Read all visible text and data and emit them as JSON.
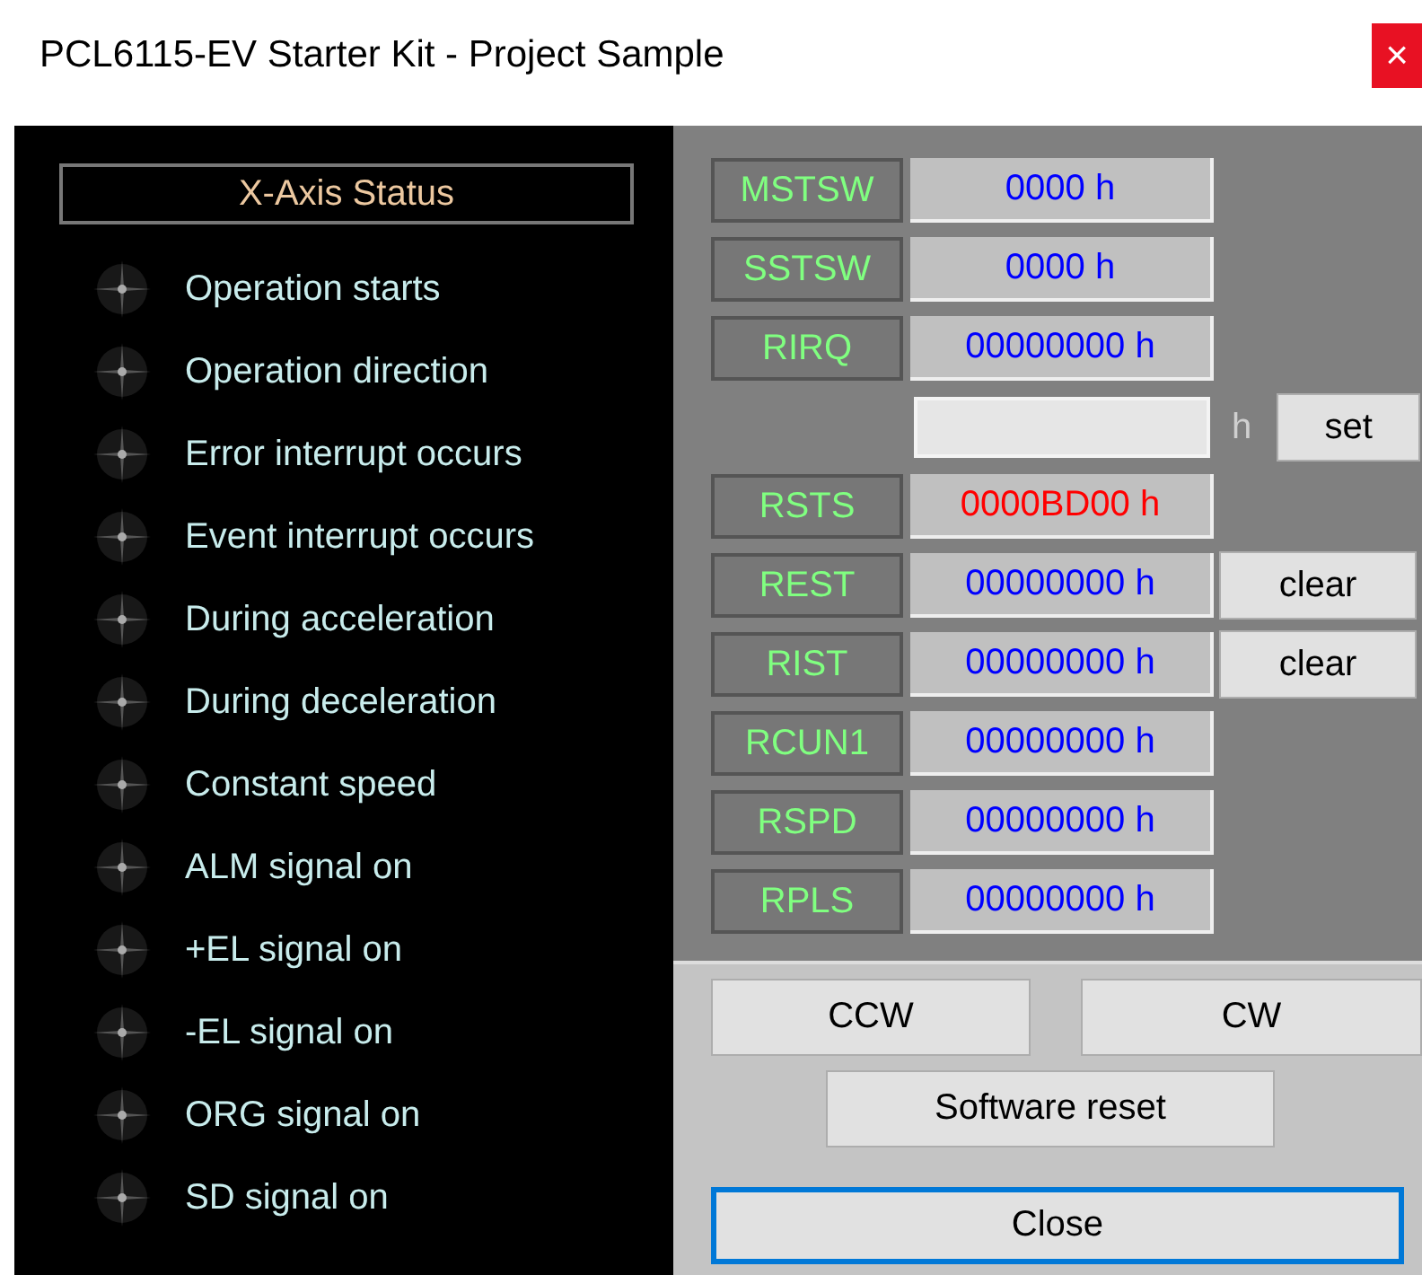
{
  "window": {
    "title": "PCL6115-EV Starter Kit - Project Sample",
    "close": "×"
  },
  "status": {
    "title": "X-Axis  Status",
    "items": [
      {
        "label": "Operation starts",
        "on": false
      },
      {
        "label": "Operation direction",
        "on": false
      },
      {
        "label": "Error interrupt occurs",
        "on": false
      },
      {
        "label": "Event interrupt occurs",
        "on": false
      },
      {
        "label": "During acceleration",
        "on": false
      },
      {
        "label": "During deceleration",
        "on": false
      },
      {
        "label": "Constant speed",
        "on": false
      },
      {
        "label": "ALM signal on",
        "on": false
      },
      {
        "label": "+EL signal on",
        "on": false
      },
      {
        "label": "-EL signal on",
        "on": false
      },
      {
        "label": "ORG signal on",
        "on": false
      },
      {
        "label": "SD signal on",
        "on": false
      }
    ]
  },
  "registers": [
    {
      "kind": "register",
      "name": "MSTSW",
      "value": "0000 h",
      "color": "#0000ff"
    },
    {
      "kind": "register",
      "name": "SSTSW",
      "value": "0000 h",
      "color": "#0000ff"
    },
    {
      "kind": "register",
      "name": "RIRQ",
      "value": "00000000 h",
      "color": "#0000ff"
    },
    {
      "kind": "input",
      "unit": "h",
      "button": "set"
    },
    {
      "kind": "register",
      "name": "RSTS",
      "value": "0000BD00 h",
      "color": "#ff0000"
    },
    {
      "kind": "register",
      "name": "REST",
      "value": "00000000 h",
      "color": "#0000ff",
      "button": "clear"
    },
    {
      "kind": "register",
      "name": "RIST",
      "value": "00000000 h",
      "color": "#0000ff",
      "button": "clear"
    },
    {
      "kind": "register",
      "name": "RCUN1",
      "value": "00000000 h",
      "color": "#0000ff"
    },
    {
      "kind": "register",
      "name": "RSPD",
      "value": "00000000 h",
      "color": "#0000ff"
    },
    {
      "kind": "register",
      "name": "RPLS",
      "value": "00000000 h",
      "color": "#0000ff"
    }
  ],
  "buttons": {
    "ccw": "CCW",
    "cw": "CW",
    "reset": "Software reset",
    "close": {
      "label": "Close",
      "focused": true
    }
  }
}
